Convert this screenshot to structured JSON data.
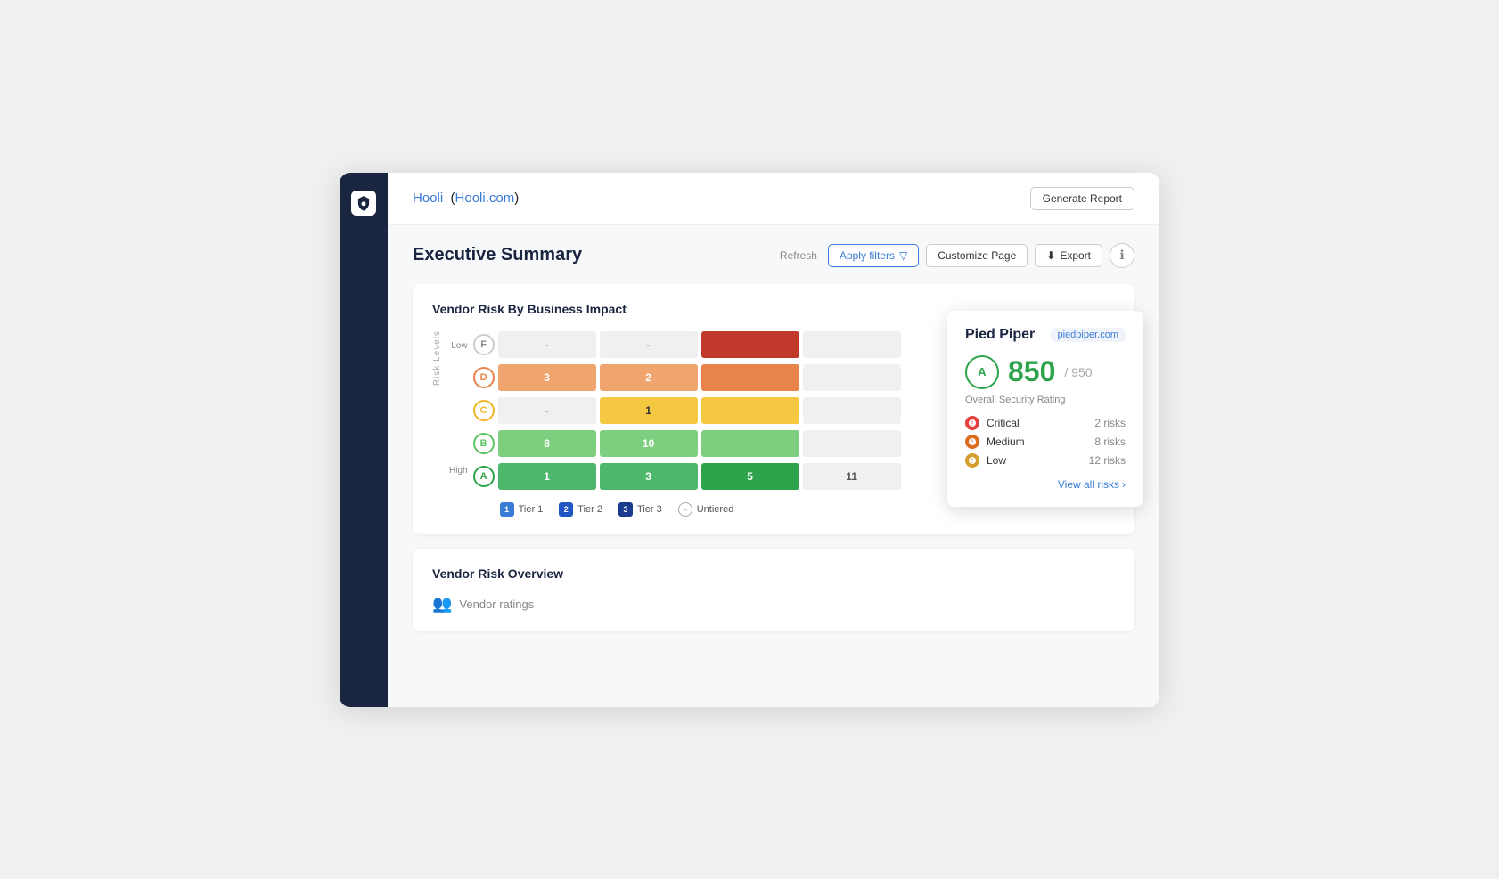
{
  "window": {
    "title": "Hooli Executive Summary"
  },
  "sidebar": {
    "logo_alt": "Shield logo"
  },
  "header": {
    "company_name": "Hooli",
    "company_url": "Hooli.com",
    "generate_report_label": "Generate Report"
  },
  "toolbar": {
    "page_title": "Executive Summary",
    "refresh_label": "Refresh",
    "apply_filters_label": "Apply filters",
    "customize_page_label": "Customize Page",
    "export_label": "Export",
    "info_symbol": "ℹ"
  },
  "chart": {
    "title": "Vendor Risk By Business Impact",
    "y_axis_title": "Risk Levels",
    "rows": [
      {
        "level_label": "Low",
        "grade": "F",
        "grade_class": "grade-f",
        "tiers": [
          "-",
          "-",
          "red",
          ""
        ]
      },
      {
        "level_label": "",
        "grade": "D",
        "grade_class": "grade-d",
        "tiers": [
          "3",
          "2",
          "orange",
          ""
        ]
      },
      {
        "level_label": "",
        "grade": "C",
        "grade_class": "grade-c",
        "tiers": [
          "-",
          "1",
          "yellow",
          ""
        ]
      },
      {
        "level_label": "",
        "grade": "B",
        "grade_class": "grade-b",
        "tiers": [
          "8",
          "10",
          "green-light",
          ""
        ]
      },
      {
        "level_label": "High",
        "grade": "A",
        "grade_class": "grade-a",
        "tiers": [
          "1",
          "3",
          "5",
          "11"
        ]
      }
    ],
    "legend": [
      {
        "badge": "1",
        "label": "Tier 1",
        "badge_class": "legend-b1"
      },
      {
        "badge": "2",
        "label": "Tier 2",
        "badge_class": "legend-b2"
      },
      {
        "badge": "3",
        "label": "Tier 3",
        "badge_class": "legend-b3"
      },
      {
        "label": "Untiered"
      }
    ]
  },
  "popup": {
    "vendor_name": "Pied Piper",
    "vendor_domain": "piedpiper.com",
    "score_grade": "A",
    "score": "850",
    "score_max": "/ 950",
    "overall_label": "Overall Security Rating",
    "risks": [
      {
        "level": "Critical",
        "count": "2 risks",
        "dot_class": "risk-dot-critical"
      },
      {
        "level": "Medium",
        "count": "8 risks",
        "dot_class": "risk-dot-medium"
      },
      {
        "level": "Low",
        "count": "12 risks",
        "dot_class": "risk-dot-low"
      }
    ],
    "view_all_label": "View all risks",
    "view_all_arrow": "›"
  },
  "vendor_risk_overview": {
    "title": "Vendor Risk Overview",
    "vendor_ratings_label": "Vendor ratings"
  }
}
